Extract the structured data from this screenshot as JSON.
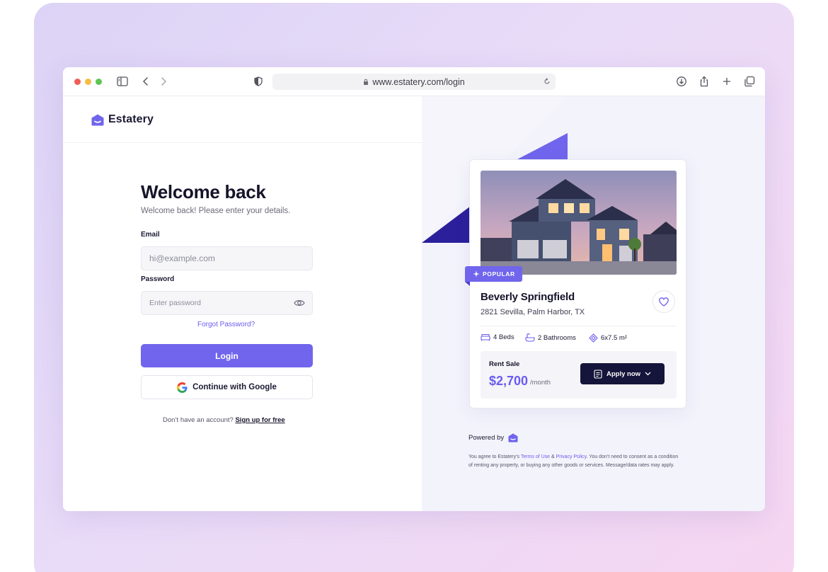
{
  "browser": {
    "url": "www.estatery.com/login"
  },
  "brand": {
    "name": "Estatery"
  },
  "login": {
    "title": "Welcome back",
    "subtitle": "Welcome back! Please enter your details.",
    "email_label": "Email",
    "email_placeholder": "hi@example.com",
    "password_label": "Password",
    "password_placeholder": "Enter password",
    "forgot_label": "Forgot Password?",
    "login_label": "Login",
    "google_label": "Continue with Google",
    "no_account_text": "Don’t have an account?",
    "signup_label": "Sign up for free"
  },
  "listing": {
    "badge": "POPULAR",
    "name": "Beverly Springfield",
    "address": "2821 Sevilla, Palm Harbor, TX",
    "beds": "4 Beds",
    "bathrooms": "2 Bathrooms",
    "area": "6x7.5 m²",
    "rent_label": "Rent Sale",
    "price": "$2,700",
    "per": "/month",
    "apply_label": "Apply now"
  },
  "footer": {
    "powered_by": "Powered by",
    "legal_1": "You agree to Estatery’s ",
    "terms": "Terms of Use",
    "amp": " & ",
    "privacy": "Privacy Policy",
    "legal_2": ". You don’t need to consent as a condition of renting any property, or buying any other goods or services. Message/data rates may apply."
  },
  "colors": {
    "accent": "#7065ec",
    "dark_button": "#15143a",
    "backdrop_start": "#dcd3f6",
    "backdrop_end": "#f6d6f1"
  },
  "icons": [
    "sidebar-toggle-icon",
    "chevron-left-icon",
    "chevron-right-icon",
    "shield-icon",
    "lock-icon",
    "reload-icon",
    "download-icon",
    "share-icon",
    "plus-icon",
    "tabs-icon",
    "estatery-logo",
    "eye-icon",
    "google-icon",
    "sparkle-icon",
    "heart-icon",
    "bed-icon",
    "bath-icon",
    "area-icon",
    "document-icon",
    "chevron-down-icon"
  ]
}
